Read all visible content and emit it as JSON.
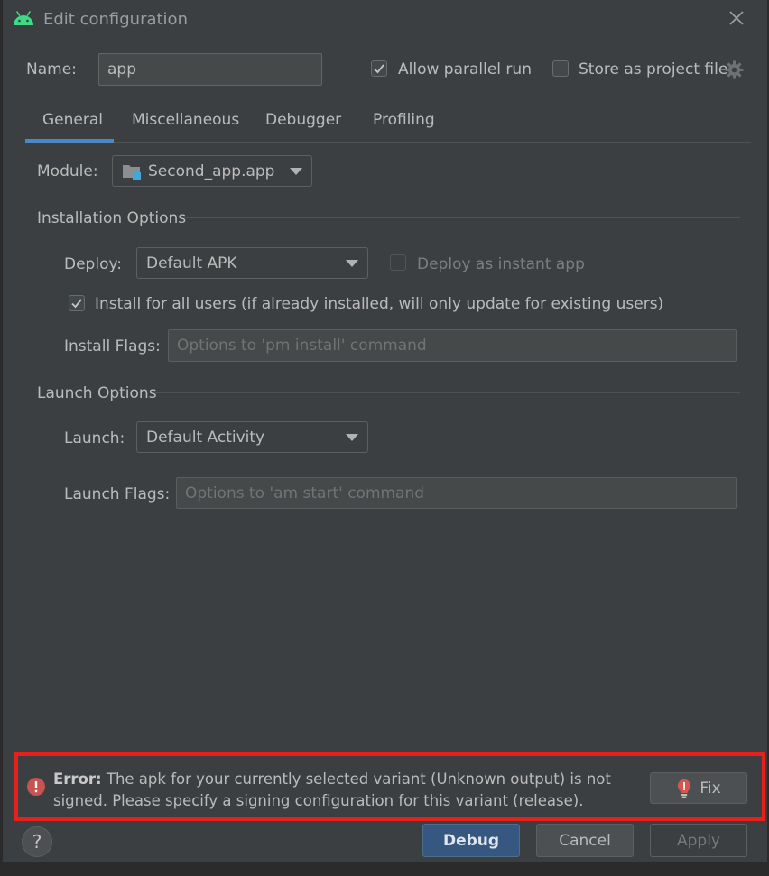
{
  "dialog": {
    "title": "Edit configuration"
  },
  "name_row": {
    "label": "Name:",
    "value": "app",
    "allow_parallel_label": "Allow parallel run",
    "allow_parallel_checked": true,
    "store_project_label": "Store as project file",
    "store_project_checked": false
  },
  "tabs": [
    {
      "label": "General",
      "active": true
    },
    {
      "label": "Miscellaneous",
      "active": false
    },
    {
      "label": "Debugger",
      "active": false
    },
    {
      "label": "Profiling",
      "active": false
    }
  ],
  "module": {
    "label": "Module:",
    "value": "Second_app.app"
  },
  "installation": {
    "title": "Installation Options",
    "deploy_label": "Deploy:",
    "deploy_value": "Default APK",
    "instant_label": "Deploy as instant app",
    "instant_checked": false,
    "install_all_label": "Install for all users (if already installed, will only update for existing users)",
    "install_all_checked": true,
    "flags_label": "Install Flags:",
    "flags_placeholder": "Options to 'pm install' command"
  },
  "launch": {
    "title": "Launch Options",
    "launch_label": "Launch:",
    "launch_value": "Default Activity",
    "flags_label": "Launch Flags:",
    "flags_placeholder": "Options to 'am start' command"
  },
  "error": {
    "prefix": "Error:",
    "message": "The apk for your currently selected variant (Unknown output) is not signed. Please specify a signing configuration for this variant (release).",
    "fix_label": "Fix"
  },
  "buttons": {
    "help": "?",
    "debug": "Debug",
    "cancel": "Cancel",
    "apply": "Apply"
  },
  "colors": {
    "background": "#3c3f41",
    "accent": "#4a88c7",
    "primary_button": "#365880",
    "error": "#e8201c",
    "android_green": "#3ddc84"
  },
  "icons": [
    "android-icon",
    "close-icon",
    "gear-icon",
    "folder-module-icon",
    "chevron-down-icon",
    "error-icon",
    "fix-bulb-icon",
    "help-icon",
    "checkmark-icon"
  ]
}
